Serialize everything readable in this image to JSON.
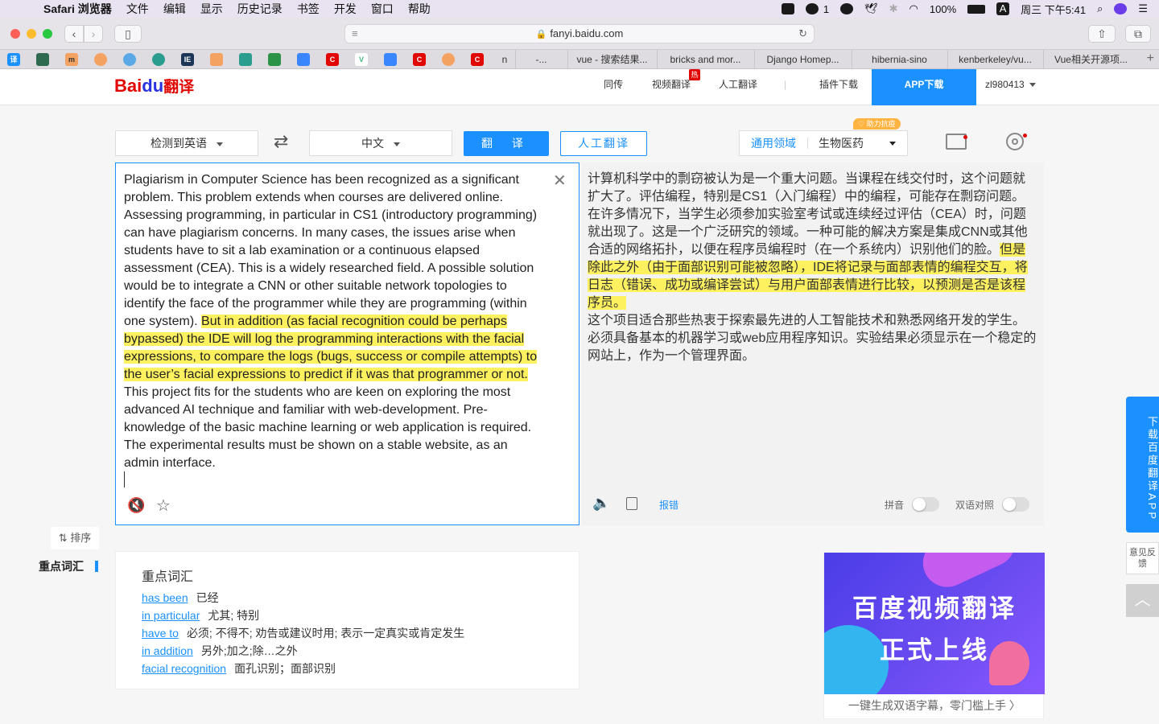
{
  "menubar": {
    "app_name": "Safari 浏览器",
    "menus": [
      "文件",
      "编辑",
      "显示",
      "历史记录",
      "书签",
      "开发",
      "窗口",
      "帮助"
    ],
    "wechat_count": "1",
    "battery": "100%",
    "ime": "A",
    "clock": "周三 下午5:41"
  },
  "browser": {
    "url": "fanyi.baidu.com",
    "tabs": [
      "-...",
      "vue - 搜索结果...",
      "bricks and mor...",
      "Django Homep...",
      "hibernia-sino",
      "kenberkeley/vu...",
      "Vue相关开源项..."
    ],
    "tab_prefix": "n"
  },
  "header": {
    "logo_bai": "Bai",
    "logo_du": "du",
    "logo_fanyi": "翻译",
    "nav": [
      "同传",
      "视频翻译",
      "人工翻译",
      "插件下载"
    ],
    "hot_badge": "热",
    "app_download": "APP下载",
    "user": "zl980413"
  },
  "controls": {
    "source_lang": "检测到英语",
    "target_lang": "中文",
    "translate_btn": "翻 译",
    "human_btn": "人工翻译",
    "domain_general": "通用领域",
    "domain_selected": "生物医药",
    "help_badge": "♡ 助力抗疫"
  },
  "source": {
    "text_before": "Plagiarism in Computer Science has been recognized as a significant problem. This problem extends when courses are delivered online. Assessing programming, in particular in CS1 (introductory programming) can have plagiarism concerns. In many cases, the issues arise when students have to sit a lab examination or a continuous elapsed assessment (CEA). This is a widely researched field. A possible solution would be to integrate a CNN or other suitable network topologies to identify the face of the programmer while they are programming (within one system). ",
    "text_highlight": "But in addition (as facial recognition could be perhaps bypassed) the IDE will log the programming interactions with the facial expressions, to compare the logs (bugs, success or compile attempts) to the user’s facial expressions to predict if it was that programmer or not.",
    "text_after": "This project fits for the students who are keen on exploring the most advanced AI technique and familiar with web-development. Pre-knowledge of the basic machine learning or web application is required. The experimental results must be shown on a stable website, as an admin interface."
  },
  "target": {
    "text_before": "计算机科学中的剽窃被认为是一个重大问题。当课程在线交付时，这个问题就扩大了。评估编程，特别是CS1（入门编程）中的编程，可能存在剽窃问题。在许多情况下，当学生必须参加实验室考试或连续经过评估（CEA）时，问题就出现了。这是一个广泛研究的领域。一种可能的解决方案是集成CNN或其他合适的网络拓扑，以便在程序员编程时（在一个系统内）识别他们的脸。",
    "text_highlight": "但是除此之外（由于面部识别可能被忽略），IDE将记录与面部表情的编程交互，将日志（错误、成功或编译尝试）与用户面部表情进行比较，以预测是否是该程序员。",
    "text_after": "这个项目适合那些热衷于探索最先进的人工智能技术和熟悉网络开发的学生。必须具备基本的机器学习或web应用程序知识。实验结果必须显示在一个稳定的网站上，作为一个管理界面。",
    "report": "报错",
    "pinyin_label": "拼音",
    "bilingual_label": "双语对照"
  },
  "lower": {
    "sort_label": "⇅ 排序",
    "side_label": "重点词汇",
    "vocab_title": "重点词汇",
    "vocab": [
      {
        "word": "has been",
        "def": "已经"
      },
      {
        "word": "in particular",
        "def": "尤其; 特别"
      },
      {
        "word": "have to",
        "def": "必须; 不得不; 劝告或建议时用; 表示一定真实或肯定发生"
      },
      {
        "word": "in addition",
        "def": "另外;加之;除…之外"
      },
      {
        "word": "facial recognition",
        "def": "面孔识别；面部识别"
      }
    ],
    "ad_line1": "百度视频翻译",
    "ad_line2": "正式上线",
    "ad_caption": "一键生成双语字幕，零门槛上手 〉"
  },
  "side": {
    "download_app": "下载百度翻译APP",
    "feedback": "意见反馈",
    "back_top": "︿"
  },
  "colors": {
    "accent": "#1a91ff",
    "brand_red": "#e10601",
    "highlight": "#fdf15f"
  }
}
